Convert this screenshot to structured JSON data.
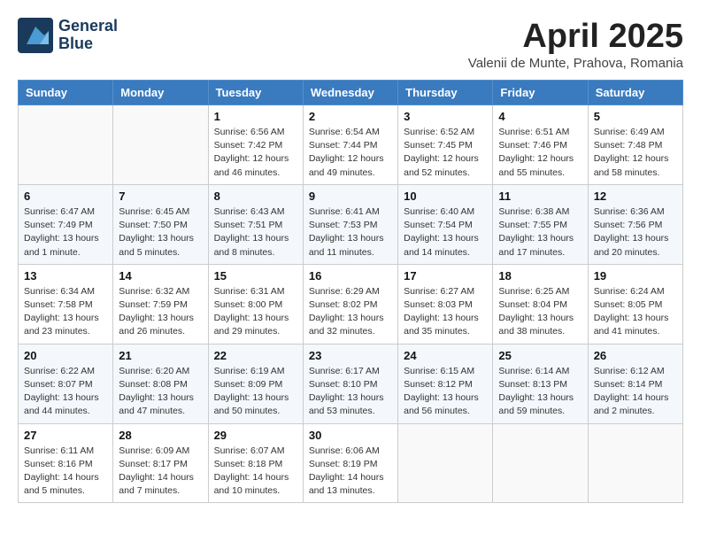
{
  "logo": {
    "line1": "General",
    "line2": "Blue"
  },
  "title": "April 2025",
  "subtitle": "Valenii de Munte, Prahova, Romania",
  "days_of_week": [
    "Sunday",
    "Monday",
    "Tuesday",
    "Wednesday",
    "Thursday",
    "Friday",
    "Saturday"
  ],
  "weeks": [
    [
      {
        "day": null,
        "info": null
      },
      {
        "day": null,
        "info": null
      },
      {
        "day": "1",
        "info": "Sunrise: 6:56 AM\nSunset: 7:42 PM\nDaylight: 12 hours and 46 minutes."
      },
      {
        "day": "2",
        "info": "Sunrise: 6:54 AM\nSunset: 7:44 PM\nDaylight: 12 hours and 49 minutes."
      },
      {
        "day": "3",
        "info": "Sunrise: 6:52 AM\nSunset: 7:45 PM\nDaylight: 12 hours and 52 minutes."
      },
      {
        "day": "4",
        "info": "Sunrise: 6:51 AM\nSunset: 7:46 PM\nDaylight: 12 hours and 55 minutes."
      },
      {
        "day": "5",
        "info": "Sunrise: 6:49 AM\nSunset: 7:48 PM\nDaylight: 12 hours and 58 minutes."
      }
    ],
    [
      {
        "day": "6",
        "info": "Sunrise: 6:47 AM\nSunset: 7:49 PM\nDaylight: 13 hours and 1 minute."
      },
      {
        "day": "7",
        "info": "Sunrise: 6:45 AM\nSunset: 7:50 PM\nDaylight: 13 hours and 5 minutes."
      },
      {
        "day": "8",
        "info": "Sunrise: 6:43 AM\nSunset: 7:51 PM\nDaylight: 13 hours and 8 minutes."
      },
      {
        "day": "9",
        "info": "Sunrise: 6:41 AM\nSunset: 7:53 PM\nDaylight: 13 hours and 11 minutes."
      },
      {
        "day": "10",
        "info": "Sunrise: 6:40 AM\nSunset: 7:54 PM\nDaylight: 13 hours and 14 minutes."
      },
      {
        "day": "11",
        "info": "Sunrise: 6:38 AM\nSunset: 7:55 PM\nDaylight: 13 hours and 17 minutes."
      },
      {
        "day": "12",
        "info": "Sunrise: 6:36 AM\nSunset: 7:56 PM\nDaylight: 13 hours and 20 minutes."
      }
    ],
    [
      {
        "day": "13",
        "info": "Sunrise: 6:34 AM\nSunset: 7:58 PM\nDaylight: 13 hours and 23 minutes."
      },
      {
        "day": "14",
        "info": "Sunrise: 6:32 AM\nSunset: 7:59 PM\nDaylight: 13 hours and 26 minutes."
      },
      {
        "day": "15",
        "info": "Sunrise: 6:31 AM\nSunset: 8:00 PM\nDaylight: 13 hours and 29 minutes."
      },
      {
        "day": "16",
        "info": "Sunrise: 6:29 AM\nSunset: 8:02 PM\nDaylight: 13 hours and 32 minutes."
      },
      {
        "day": "17",
        "info": "Sunrise: 6:27 AM\nSunset: 8:03 PM\nDaylight: 13 hours and 35 minutes."
      },
      {
        "day": "18",
        "info": "Sunrise: 6:25 AM\nSunset: 8:04 PM\nDaylight: 13 hours and 38 minutes."
      },
      {
        "day": "19",
        "info": "Sunrise: 6:24 AM\nSunset: 8:05 PM\nDaylight: 13 hours and 41 minutes."
      }
    ],
    [
      {
        "day": "20",
        "info": "Sunrise: 6:22 AM\nSunset: 8:07 PM\nDaylight: 13 hours and 44 minutes."
      },
      {
        "day": "21",
        "info": "Sunrise: 6:20 AM\nSunset: 8:08 PM\nDaylight: 13 hours and 47 minutes."
      },
      {
        "day": "22",
        "info": "Sunrise: 6:19 AM\nSunset: 8:09 PM\nDaylight: 13 hours and 50 minutes."
      },
      {
        "day": "23",
        "info": "Sunrise: 6:17 AM\nSunset: 8:10 PM\nDaylight: 13 hours and 53 minutes."
      },
      {
        "day": "24",
        "info": "Sunrise: 6:15 AM\nSunset: 8:12 PM\nDaylight: 13 hours and 56 minutes."
      },
      {
        "day": "25",
        "info": "Sunrise: 6:14 AM\nSunset: 8:13 PM\nDaylight: 13 hours and 59 minutes."
      },
      {
        "day": "26",
        "info": "Sunrise: 6:12 AM\nSunset: 8:14 PM\nDaylight: 14 hours and 2 minutes."
      }
    ],
    [
      {
        "day": "27",
        "info": "Sunrise: 6:11 AM\nSunset: 8:16 PM\nDaylight: 14 hours and 5 minutes."
      },
      {
        "day": "28",
        "info": "Sunrise: 6:09 AM\nSunset: 8:17 PM\nDaylight: 14 hours and 7 minutes."
      },
      {
        "day": "29",
        "info": "Sunrise: 6:07 AM\nSunset: 8:18 PM\nDaylight: 14 hours and 10 minutes."
      },
      {
        "day": "30",
        "info": "Sunrise: 6:06 AM\nSunset: 8:19 PM\nDaylight: 14 hours and 13 minutes."
      },
      {
        "day": null,
        "info": null
      },
      {
        "day": null,
        "info": null
      },
      {
        "day": null,
        "info": null
      }
    ]
  ]
}
